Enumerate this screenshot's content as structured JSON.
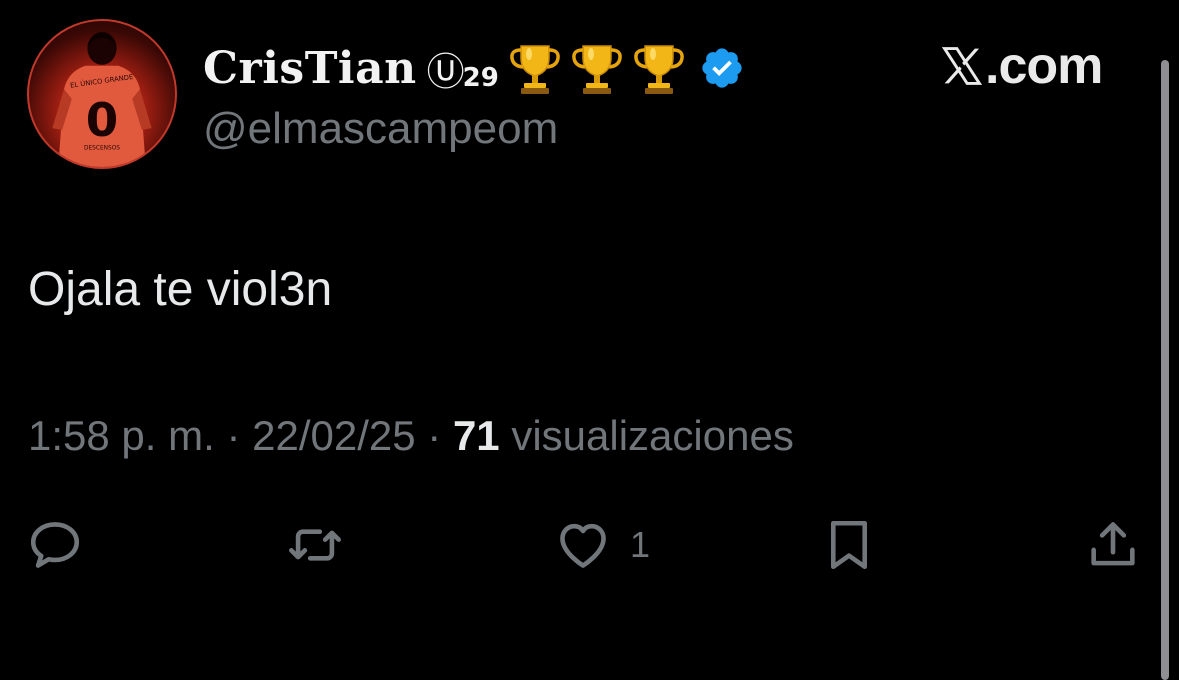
{
  "user": {
    "display_name": "CrisTian",
    "u_mark": "Ⓤ",
    "u_sub": "29",
    "handle": "@elmascampeom",
    "avatar": {
      "shirt_top_text": "EL ÚNICO GRANDE",
      "shirt_number": "0",
      "shirt_bottom_text": "DESCENSOS"
    },
    "badges": [
      "trophy-icon",
      "trophy-icon",
      "trophy-icon",
      "verified-icon"
    ],
    "verified_color": "#1d9bf0"
  },
  "brand": {
    "text": ".com"
  },
  "tweet": {
    "text": "Ojala te viol3n",
    "time": "1:58 p. m.",
    "sep1": "·",
    "date": "22/02/25",
    "sep2": "·",
    "views_count": "71",
    "views_label": "visualizaciones"
  },
  "actions": {
    "reply_icon": "reply-icon",
    "retweet_icon": "retweet-icon",
    "like_icon": "heart-icon",
    "like_count": "1",
    "bookmark_icon": "bookmark-icon",
    "share_icon": "share-icon"
  },
  "colors": {
    "background": "#000000",
    "text": "#e7e9ea",
    "muted": "#71767b",
    "accent_red": "#c0392b"
  }
}
